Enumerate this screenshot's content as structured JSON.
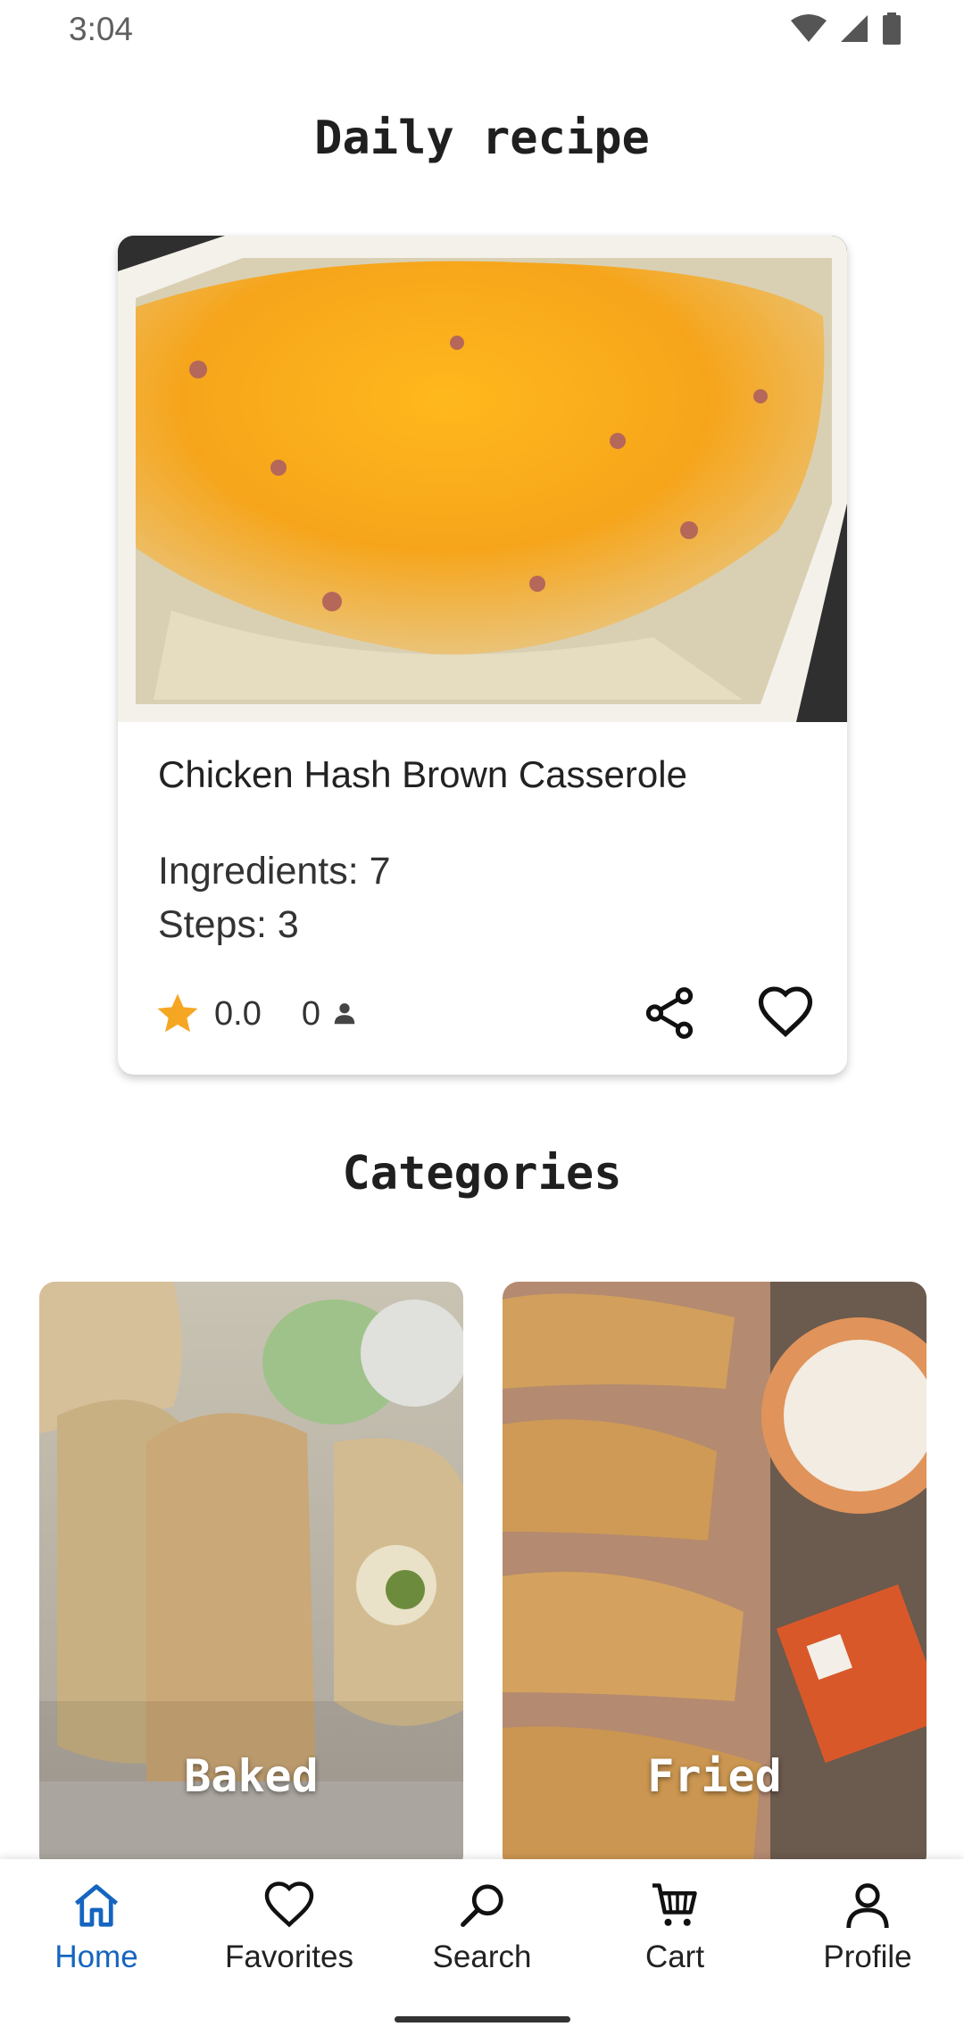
{
  "status_bar": {
    "time": "3:04"
  },
  "daily": {
    "title": "Daily recipe",
    "recipe": {
      "name": "Chicken Hash Brown Casserole",
      "ingredients": "Ingredients: 7",
      "steps": "Steps: 3",
      "rating": "0.0",
      "reviews": "0"
    }
  },
  "categories": {
    "title": "Categories",
    "items": [
      {
        "label": "Baked"
      },
      {
        "label": "Fried"
      }
    ]
  },
  "bottom_nav": {
    "items": [
      {
        "label": "Home",
        "icon": "home-icon",
        "active": true
      },
      {
        "label": "Favorites",
        "icon": "heart-icon"
      },
      {
        "label": "Search",
        "icon": "search-icon"
      },
      {
        "label": "Cart",
        "icon": "cart-icon"
      },
      {
        "label": "Profile",
        "icon": "person-icon"
      }
    ]
  },
  "colors": {
    "accent": "#1565c0",
    "star": "#f5a623"
  }
}
